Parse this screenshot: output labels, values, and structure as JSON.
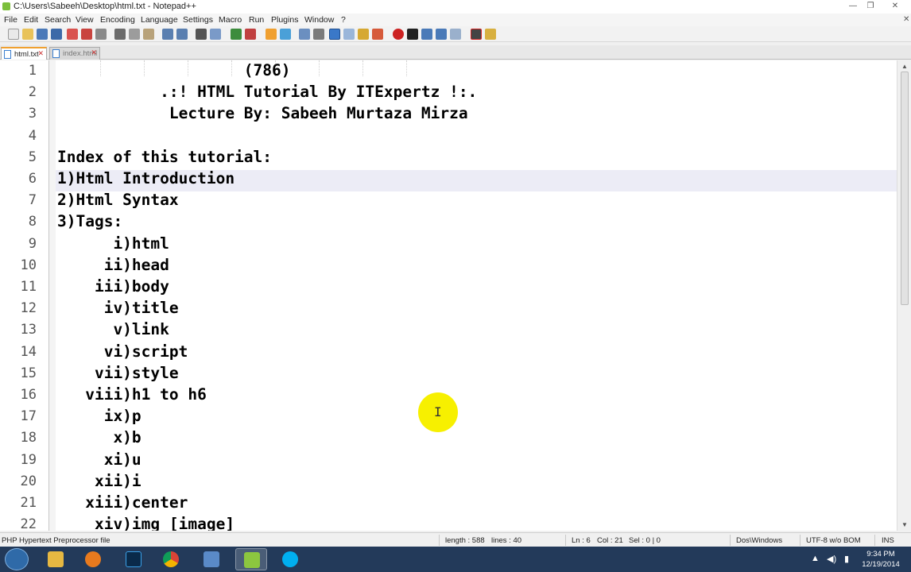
{
  "window": {
    "title": "C:\\Users\\Sabeeh\\Desktop\\html.txt - Notepad++",
    "min": "—",
    "max": "❐",
    "close": "✕"
  },
  "menu": {
    "items": [
      "File",
      "Edit",
      "Search",
      "View",
      "Encoding",
      "Language",
      "Settings",
      "Macro",
      "Run",
      "Plugins",
      "Window",
      "?"
    ],
    "close": "✕"
  },
  "tabs": [
    {
      "label": "html.txt",
      "close": "✕"
    },
    {
      "label": "index.html",
      "close": "✕"
    }
  ],
  "editor": {
    "lines": [
      "                    (786)",
      "           .:! HTML Tutorial By ITExpertz !:.",
      "            Lecture By: Sabeeh Murtaza Mirza",
      "",
      "Index of this tutorial:",
      "1)Html Introduction",
      "2)Html Syntax",
      "3)Tags:",
      "      i)html",
      "     ii)head",
      "    iii)body",
      "     iv)title",
      "      v)link",
      "     vi)script",
      "    vii)style",
      "   viii)h1 to h6",
      "     ix)p",
      "      x)b",
      "     xi)u",
      "    xii)i",
      "   xiii)center",
      "    xiv)img [image]"
    ],
    "current_line": 6,
    "scroll_position": 0.0
  },
  "status": {
    "file_type": "PHP Hypertext Preprocessor file",
    "length": "length : 588",
    "lines": "lines : 40",
    "ln": "Ln : 6",
    "col": "Col : 21",
    "sel": "Sel : 0 | 0",
    "eol": "Dos\\Windows",
    "encoding": "UTF-8 w/o BOM",
    "mode": "INS"
  },
  "taskbar": {
    "apps": [
      "file-explorer",
      "media-player",
      "photoshop",
      "chrome",
      "network-tool",
      "notepad-plus-plus",
      "skype"
    ],
    "time": "9:34 PM",
    "date": "12/19/2014"
  },
  "colors": {
    "current_line_bg": "#ececf6",
    "cursor_highlight": "#f7f000",
    "taskbar_bg": "#233a5a",
    "tab_accent": "#f0a030"
  }
}
